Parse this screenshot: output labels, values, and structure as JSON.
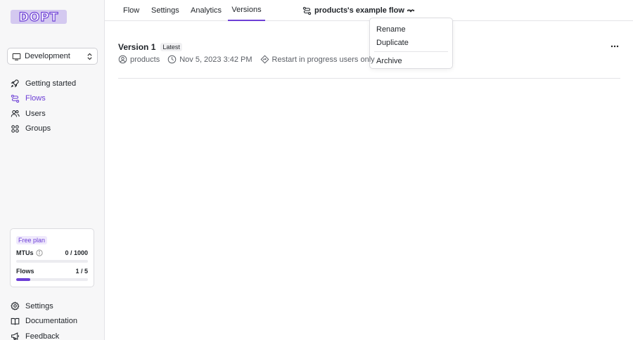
{
  "logo": {
    "text": "DOPT"
  },
  "environment": {
    "selected": "Development"
  },
  "sidebar": {
    "nav": [
      {
        "label": "Getting started",
        "icon": "rocket-icon",
        "active": false
      },
      {
        "label": "Flows",
        "icon": "flow-icon",
        "active": true
      },
      {
        "label": "Users",
        "icon": "users-icon",
        "active": false
      },
      {
        "label": "Groups",
        "icon": "groups-icon",
        "active": false
      }
    ],
    "bottom": [
      {
        "label": "Settings",
        "icon": "gear-icon"
      },
      {
        "label": "Documentation",
        "icon": "book-icon"
      },
      {
        "label": "Feedback",
        "icon": "megaphone-icon"
      }
    ]
  },
  "plan": {
    "badge": "Free plan",
    "mtus_label": "MTUs",
    "mtus_value": "0 / 1000",
    "mtus_fraction": 0,
    "flows_label": "Flows",
    "flows_value": "1 / 5",
    "flows_fraction": 0.2
  },
  "tabs": [
    {
      "label": "Flow",
      "active": false
    },
    {
      "label": "Settings",
      "active": false
    },
    {
      "label": "Analytics",
      "active": false
    },
    {
      "label": "Versions",
      "active": true
    }
  ],
  "flow": {
    "name": "products's example flow"
  },
  "menu": {
    "items": [
      "Rename",
      "Duplicate"
    ],
    "danger_items": [
      "Archive"
    ]
  },
  "version": {
    "name": "Version 1",
    "badge": "Latest",
    "creator": "products",
    "timestamp": "Nov 5, 2023 3:42 PM",
    "restart": "Restart in progress users only"
  },
  "colors": {
    "accent": "#6d3fd6",
    "sidebar_bg": "#f7f7f8"
  }
}
